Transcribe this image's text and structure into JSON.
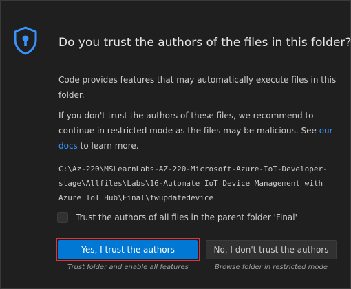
{
  "dialog": {
    "title": "Do you trust the authors of the files in this folder?",
    "paragraph1": "Code provides features that may automatically execute files in this folder.",
    "paragraph2_prefix": "If you don't trust the authors of these files, we recommend to continue in restricted mode as the files may be malicious. See ",
    "paragraph2_link": "our docs",
    "paragraph2_suffix": " to learn more.",
    "folder_path": "C:\\Az-220\\MSLearnLabs-AZ-220-Microsoft-Azure-IoT-Developer-stage\\Allfiles\\Labs\\16-Automate IoT Device Management with Azure IoT Hub\\Final\\fwupdatedevice",
    "checkbox_label": "Trust the authors of all files in the parent folder 'Final'",
    "trust_button": "Yes, I trust the authors",
    "trust_caption": "Trust folder and enable all features",
    "distrust_button": "No, I don't trust the authors",
    "distrust_caption": "Browse folder in restricted mode",
    "icon": "shield-lock-icon",
    "colors": {
      "background": "#1f1f1f",
      "accent": "#0078d4",
      "link": "#3794ff",
      "highlight": "#e0323c"
    }
  }
}
